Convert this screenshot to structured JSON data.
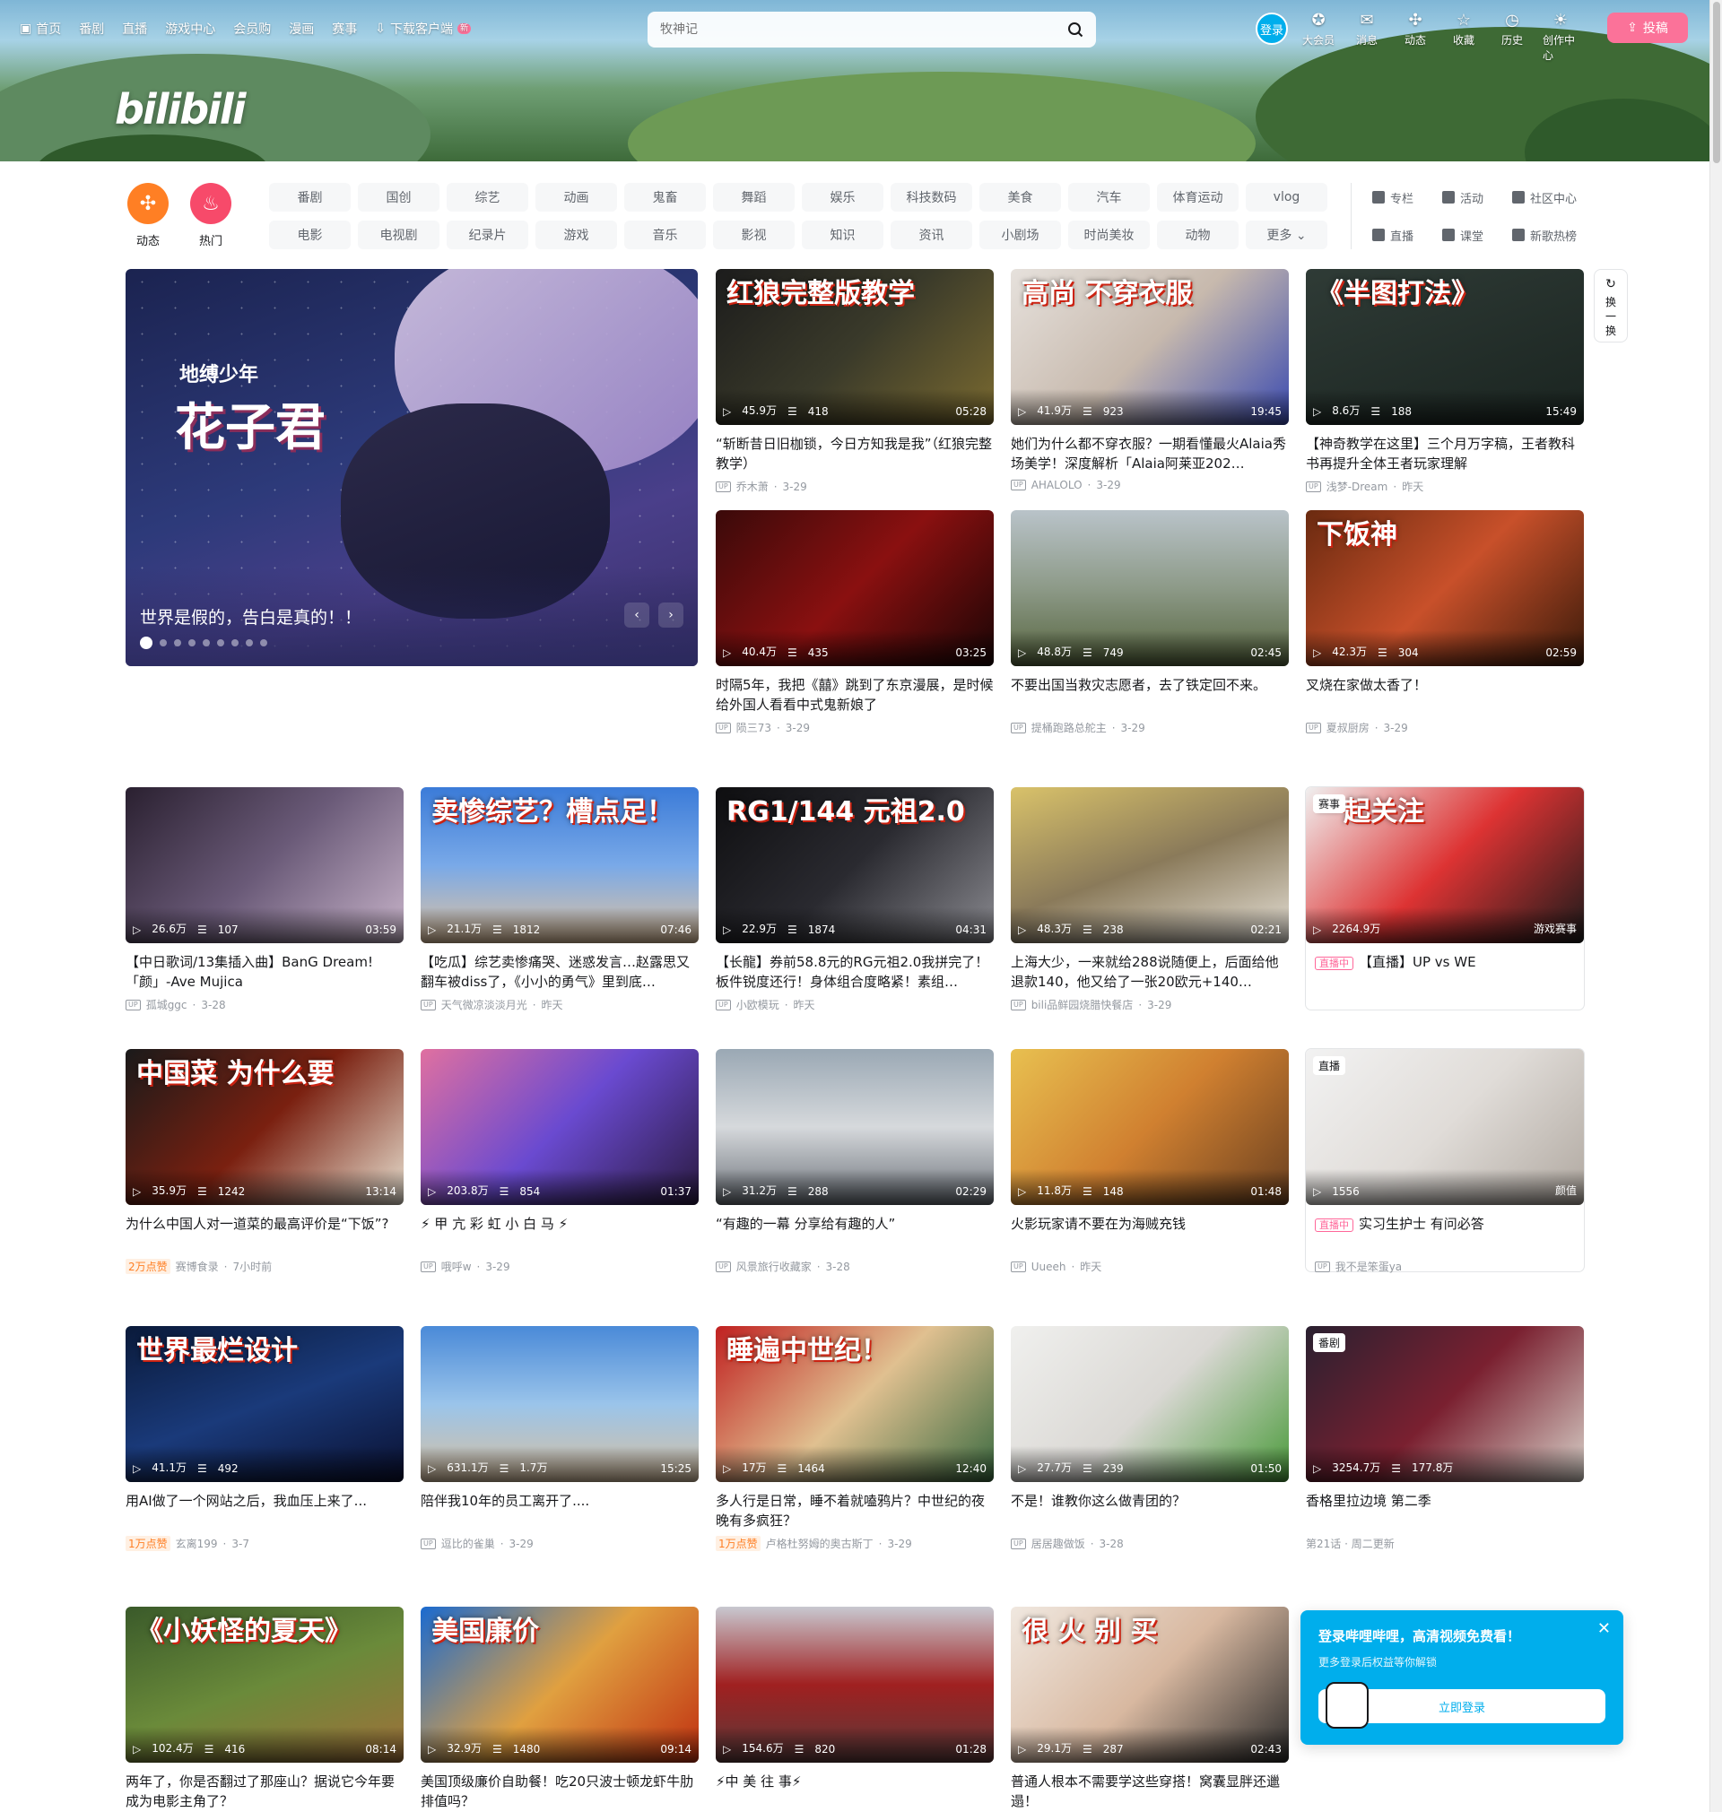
{
  "nav": {
    "items": [
      {
        "label": "首页",
        "icon": "tv-icon"
      },
      {
        "label": "番剧"
      },
      {
        "label": "直播"
      },
      {
        "label": "游戏中心"
      },
      {
        "label": "会员购"
      },
      {
        "label": "漫画"
      },
      {
        "label": "赛事"
      },
      {
        "label": "下载客户端",
        "icon": "download-icon",
        "badge": "新"
      }
    ],
    "search_placeholder": "牧神记",
    "login": "登录",
    "right": [
      {
        "label": "大会员",
        "icon": "vip-icon",
        "glyph": "✪"
      },
      {
        "label": "消息",
        "icon": "mail-icon",
        "glyph": "✉"
      },
      {
        "label": "动态",
        "icon": "windmill-icon",
        "glyph": "✣"
      },
      {
        "label": "收藏",
        "icon": "star-icon",
        "glyph": "☆"
      },
      {
        "label": "历史",
        "icon": "clock-icon",
        "glyph": "◷"
      },
      {
        "label": "创作中心",
        "icon": "bulb-icon",
        "glyph": "☀"
      }
    ],
    "upload": "投稿",
    "logo": "bilibili"
  },
  "circles": [
    {
      "label": "动态",
      "icon": "windmill-icon",
      "glyph": "✣",
      "color": "#ff7f24"
    },
    {
      "label": "热门",
      "icon": "flame-icon",
      "glyph": "♨",
      "color": "#f74a6a"
    }
  ],
  "chips": [
    "番剧",
    "国创",
    "综艺",
    "动画",
    "鬼畜",
    "舞蹈",
    "娱乐",
    "科技数码",
    "美食",
    "汽车",
    "体育运动",
    "vlog",
    "电影",
    "电视剧",
    "纪录片",
    "游戏",
    "音乐",
    "影视",
    "知识",
    "资讯",
    "小剧场",
    "时尚美妆",
    "动物",
    "更多 ⌄"
  ],
  "right_links": [
    {
      "label": "专栏",
      "icon": "column-icon"
    },
    {
      "label": "活动",
      "icon": "flag-icon"
    },
    {
      "label": "社区中心",
      "icon": "community-icon"
    },
    {
      "label": "直播",
      "icon": "live-icon"
    },
    {
      "label": "课堂",
      "icon": "classroom-icon"
    },
    {
      "label": "新歌热榜",
      "icon": "music-chart-icon"
    }
  ],
  "carousel": {
    "title": "花子君",
    "sub": "地缚少年",
    "caption": "世界是假的，告白是真的！！",
    "dots": 9,
    "active": 0
  },
  "refresh": {
    "label": "换一换"
  },
  "cards": [
    {
      "views": "45.9万",
      "danmaku": "418",
      "dur": "05:28",
      "title": "“斩断昔日旧枷锁，今日方知我是我”（红狼完整教学）",
      "author": "乔木萧",
      "date": "3-29",
      "headline": "红狼完整版教学",
      "bg": "linear-gradient(135deg,#1c1c1c,#3a3a2a,#7a6a30)"
    },
    {
      "views": "41.9万",
      "danmaku": "923",
      "dur": "19:45",
      "title": "她们为什么都不穿衣服？一期看懂最火Alaia秀场美学！深度解析「Alaia阿莱亚202…",
      "author": "AHALOLO",
      "date": "3-29",
      "headline": "高尚 不穿衣服",
      "bg": "linear-gradient(135deg,#e6e1dc,#c7b9ad,#3a4ab0)"
    },
    {
      "views": "8.6万",
      "danmaku": "188",
      "dur": "15:49",
      "title": "【神奇教学在这里】三个月万字稿，王者教科书再提升全体王者玩家理解",
      "author": "浅梦-Dream",
      "date": "昨天",
      "headline": "《半图打法》",
      "bg": "linear-gradient(160deg,#2f3b36,#1a2420)"
    },
    {
      "views": "40.4万",
      "danmaku": "435",
      "dur": "03:25",
      "title": "时隔5年，我把《囍》跳到了东京漫展，是时候给外国人看看中式鬼新娘了",
      "author": "陨三73",
      "date": "3-29",
      "headline": "",
      "bg": "linear-gradient(135deg,#3a0a0a,#8a1010,#1a0505)"
    },
    {
      "views": "48.8万",
      "danmaku": "749",
      "dur": "02:45",
      "title": "不要出国当救灾志愿者，去了铁定回不来。",
      "author": "提桶跑路总舵主",
      "date": "3-29",
      "headline": "",
      "bg": "linear-gradient(180deg,#b9c3c9,#8d9a88,#56643e)"
    },
    {
      "views": "42.3万",
      "danmaku": "304",
      "dur": "02:59",
      "title": "叉烧在家做太香了！",
      "author": "夏叔厨房",
      "date": "3-29",
      "headline": "下饭神",
      "bg": "linear-gradient(135deg,#6a2a10,#c8502a,#3a1a0a)"
    },
    {
      "views": "26.6万",
      "danmaku": "107",
      "dur": "03:59",
      "title": "【中日歌词/13集插入曲】BanG Dream!「颜」-Ave Mujica",
      "author": "孤城ggc",
      "date": "3-28",
      "headline": "",
      "bg": "linear-gradient(135deg,#2a2030,#6a5a78,#c7b3c9)"
    },
    {
      "views": "21.1万",
      "danmaku": "1812",
      "dur": "07:46",
      "title": "【吃瓜】综艺卖惨痛哭、迷惑发言…赵露思又翻车被diss了，《小小的勇气》里到底…",
      "author": "天气微凉淡淡月光",
      "date": "昨天",
      "headline": "卖惨综艺？槽点足！",
      "bg": "linear-gradient(180deg,#3b7bd8,#79a9e8,#e2c39e)"
    },
    {
      "views": "22.9万",
      "danmaku": "1874",
      "dur": "04:31",
      "title": "【长龍】券前58.8元的RG元祖2.0我拼完了！板件锐度还行！身体组合度略紧！素组…",
      "author": "小欧模玩",
      "date": "昨天",
      "headline": "RG1/144 元祖2.0",
      "bg": "linear-gradient(135deg,#0e0e10,#2a2a30,#8a8a90)"
    },
    {
      "views": "48.3万",
      "danmaku": "238",
      "dur": "02:21",
      "title": "上海大少，一来就给288说随便上，后面给他退款140，他又给了一张20欧元+140…",
      "author": "bili品鲜园烧腊快餐店",
      "date": "3-29",
      "headline": "",
      "bg": "linear-gradient(160deg,#d9c26a,#8a7a5a,#e7e2d9)"
    },
    {
      "views": "2264.9万",
      "danmaku": "",
      "dur": "游戏赛事",
      "title": "【直播】UP vs WE",
      "author": "",
      "date": "",
      "headline": "一起关注",
      "badge": "赛事",
      "live": true,
      "bg": "linear-gradient(135deg,#f0f0f0,#d33,#1a1a1a)"
    },
    {
      "views": "35.9万",
      "danmaku": "1242",
      "dur": "13:14",
      "title": "为什么中国人对一道菜的最高评价是“下饭”?",
      "author": "赛博食录",
      "date": "7小时前",
      "likes": "2万点赞",
      "headline": "中国菜 为什么要",
      "bg": "linear-gradient(135deg,#1a1a1a,#7a2010,#e8e0d0)"
    },
    {
      "views": "203.8万",
      "danmaku": "854",
      "dur": "01:37",
      "title": "⚡ 甲 亢 彩 虹 小 白 马 ⚡",
      "author": "哦呼w",
      "date": "3-29",
      "headline": "",
      "bg": "linear-gradient(135deg,#e070a0,#6a4ad0,#2a1a40)"
    },
    {
      "views": "31.2万",
      "danmaku": "288",
      "dur": "02:29",
      "title": "“有趣的一幕 分享给有趣的人”",
      "author": "风景旅行收藏家",
      "date": "3-28",
      "headline": "",
      "bg": "linear-gradient(180deg,#9aa8b4,#d6d9dc,#6a7078)"
    },
    {
      "views": "11.8万",
      "danmaku": "148",
      "dur": "01:48",
      "title": "火影玩家请不要在为海贼充钱",
      "author": "Uueeh",
      "date": "昨天",
      "headline": "",
      "bg": "linear-gradient(135deg,#e8c050,#d08030,#6a4020)"
    },
    {
      "views": "1556",
      "danmaku": "",
      "dur": "颜值",
      "title": "实习生护士 有问必答",
      "author": "我不是笨蛋ya",
      "date": "",
      "headline": "",
      "badge": "直播",
      "live": true,
      "bg": "linear-gradient(135deg,#f2f2f2,#e0dcd8,#b0a8a0)"
    },
    {
      "views": "41.1万",
      "danmaku": "492",
      "dur": "",
      "title": "用AI做了一个网站之后，我血压上来了...",
      "author": "玄离199",
      "date": "3-7",
      "likes": "1万点赞",
      "headline": "世界最烂设计",
      "bg": "linear-gradient(160deg,#0a1a3a,#1a3a7a,#0a1030)"
    },
    {
      "views": "631.1万",
      "danmaku": "1.7万",
      "dur": "15:25",
      "title": "陪伴我10年的员工离开了....",
      "author": "逗比的雀巢",
      "date": "3-29",
      "headline": "",
      "bg": "linear-gradient(180deg,#4a8ad8,#9ac4ea,#d8c0a0)"
    },
    {
      "views": "17万",
      "danmaku": "1464",
      "dur": "12:40",
      "title": "多人行是日常，睡不着就嗑鸦片？中世纪的夜晚有多疯狂？",
      "author": "卢格杜努姆的奥古斯丁",
      "date": "3-29",
      "likes": "1万点赞",
      "headline": "睡遍中世纪！",
      "bg": "linear-gradient(135deg,#c02020,#e0c090,#3a6a40)"
    },
    {
      "views": "27.7万",
      "danmaku": "239",
      "dur": "01:50",
      "title": "不是！谁教你这么做青团的？",
      "author": "居居趣做饭",
      "date": "3-28",
      "headline": "",
      "bg": "linear-gradient(135deg,#f0f0ee,#dad8d4,#4a9a3a)"
    },
    {
      "views": "3254.7万",
      "danmaku": "177.8万",
      "dur": "",
      "title": "香格里拉边境 第二季",
      "author": "",
      "date": "第21话 · 周二更新",
      "headline": "",
      "badge": "番剧",
      "bg": "linear-gradient(135deg,#2a2030,#7a2030,#d8d0c8)"
    },
    {
      "views": "102.4万",
      "danmaku": "416",
      "dur": "08:14",
      "title": "两年了，你是否翻过了那座山？据说它今年要成为电影主角了？",
      "author": "",
      "date": "",
      "headline": "《小妖怪的夏天》",
      "bg": "linear-gradient(160deg,#3a5a2a,#6a8a3a,#a0703a)"
    },
    {
      "views": "32.9万",
      "danmaku": "1480",
      "dur": "09:14",
      "title": "美国顶级廉价自助餐！吃20只波士顿龙虾牛肋排值吗？",
      "author": "",
      "date": "",
      "headline": "美国廉价",
      "bg": "linear-gradient(135deg,#1a6ad0,#e0a040,#c03010)"
    },
    {
      "views": "154.6万",
      "danmaku": "820",
      "dur": "01:28",
      "title": "⚡中 美 往 事⚡",
      "author": "",
      "date": "",
      "headline": "",
      "bg": "linear-gradient(180deg,#c8c8d0,#a02020,#5a3a3a)"
    },
    {
      "views": "29.1万",
      "danmaku": "287",
      "dur": "02:43",
      "title": "普通人根本不需要学这些穿搭！窝囊显胖还邋遢！",
      "author": "",
      "date": "",
      "headline": "很 火 别 买",
      "bg": "linear-gradient(135deg,#f0e8e0,#d8b8a0,#2a2a2a)"
    }
  ],
  "popup": {
    "title": "登录哔哩哔哩，高清视频免费看！",
    "sub": "更多登录后权益等你解锁",
    "button": "立即登录"
  }
}
